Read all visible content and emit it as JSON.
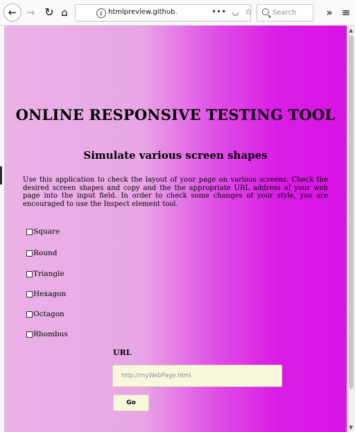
{
  "browser": {
    "back_icon": "←",
    "forward_icon": "→",
    "reload_icon": "↻",
    "home_icon": "⌂",
    "url_visible": "htmlpreview.github.io/",
    "url_faded": "?",
    "page_actions_icon": "•••",
    "pocket_icon": "◡",
    "bookmark_icon": "☆",
    "search_placeholder": "Search",
    "overflow_icon": "»",
    "menu_icon": "≡"
  },
  "page": {
    "title": "ONLINE RESPONSIVE TESTING TOOL",
    "subtitle": "Simulate various screen shapes",
    "description": "Use this application to check the layout of your page on various screens. Check the desired screen shapes and copy and the the appropriate URL address of your web page into the input field. In order to check some changes of your style, you are encouraged to use the Inspect element tool.",
    "shapes": [
      "Square",
      "Round",
      "Triangle",
      "Hexagon",
      "Octagon",
      "Rhombus"
    ],
    "url_label": "URL",
    "url_placeholder": "http://myWebPage.html",
    "go_label": "Go"
  },
  "colors": {
    "gradient_start": "#ebb2e6",
    "gradient_end": "#d915e5",
    "input_bg": "#faf8dc"
  }
}
